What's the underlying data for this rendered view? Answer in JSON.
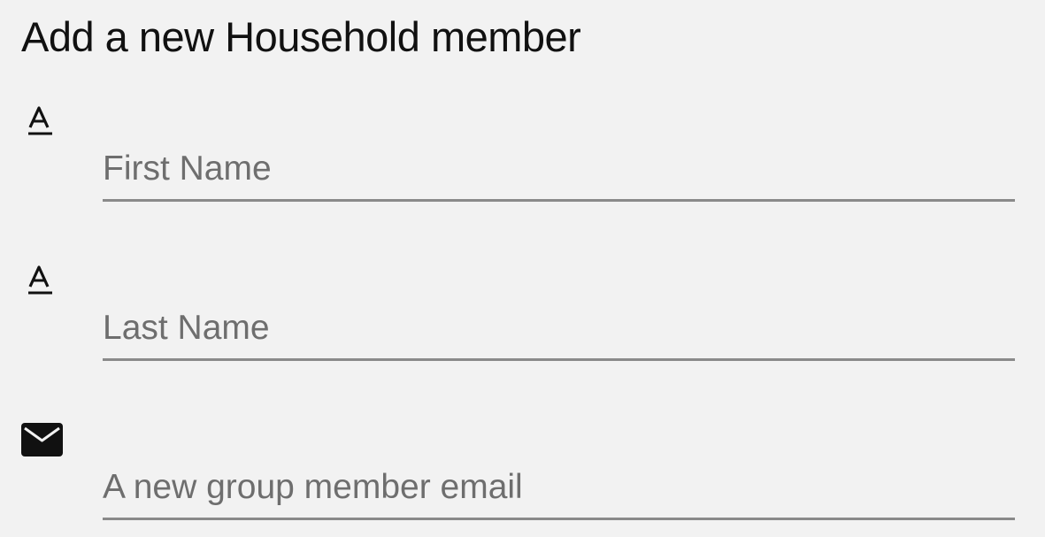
{
  "form": {
    "title": "Add a new Household member",
    "fields": [
      {
        "icon": "text-format-icon",
        "placeholder": "First Name",
        "value": ""
      },
      {
        "icon": "text-format-icon",
        "placeholder": "Last Name",
        "value": ""
      },
      {
        "icon": "mail-icon",
        "placeholder": "A new group member email",
        "value": ""
      }
    ]
  },
  "colors": {
    "background": "#f2f2f2",
    "text": "#111111",
    "placeholder": "#6e6e6e",
    "underline": "#8a8a8a"
  }
}
